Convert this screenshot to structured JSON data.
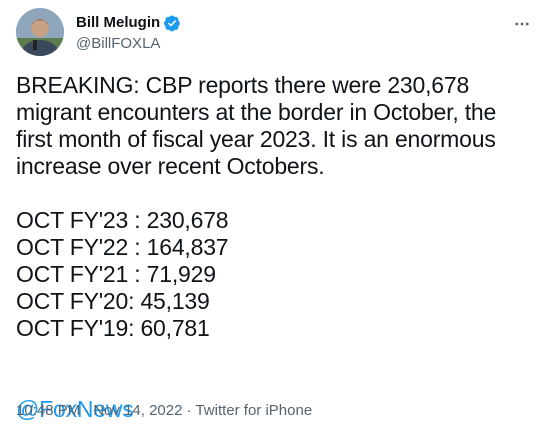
{
  "author": {
    "display_name": "Bill Melugin",
    "handle": "@BillFOXLA",
    "verified_icon": "verified-badge-icon",
    "avatar": "avatar-photo"
  },
  "more_icon": "more-horizontal-icon",
  "tweet": {
    "text": "BREAKING: CBP reports there were 230,678 migrant encounters at the border in October, the first month of fiscal year 2023. It is an enormous increase over recent Octobers.",
    "stats": [
      "OCT FY'23 : 230,678",
      "OCT FY'22 : 164,837",
      "OCT FY'21 : 71,929",
      "OCT FY'20: 45,139",
      "OCT FY'19: 60,781"
    ],
    "mention": "@FoxNews"
  },
  "meta": {
    "time": "10:48 PM",
    "separator_1": "·",
    "date": "Nov 14, 2022",
    "separator_2": "·",
    "source": "Twitter for iPhone"
  },
  "colors": {
    "link": "#1d9bf0",
    "text": "#0f1419",
    "secondary": "#536471"
  }
}
